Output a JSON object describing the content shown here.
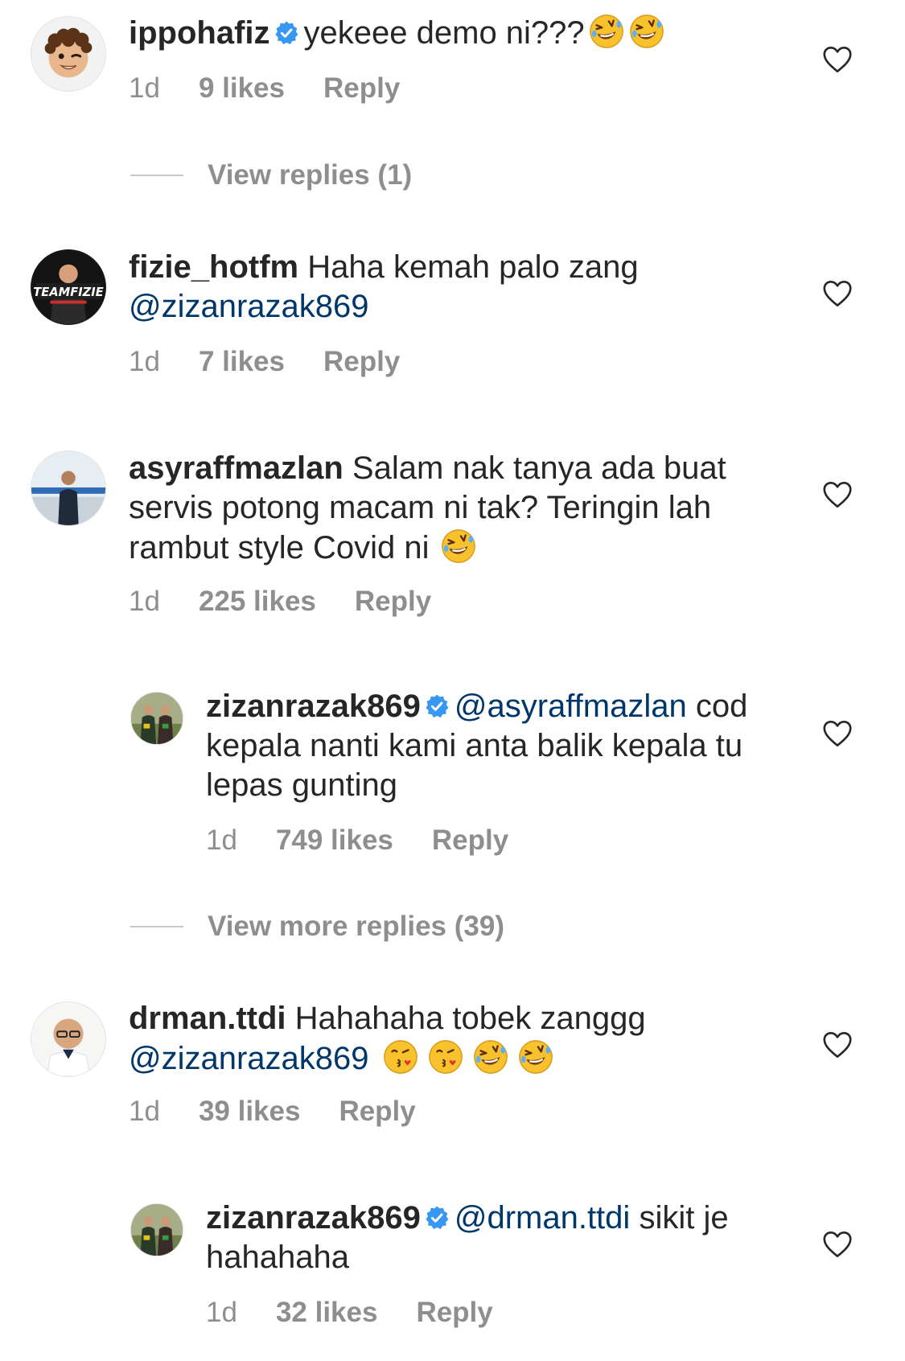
{
  "colors": {
    "text": "#262626",
    "secondary": "#8e8e8e",
    "mention": "#00376b",
    "verified": "#3897f0"
  },
  "comments": [
    {
      "username": "ippohafiz",
      "verified": true,
      "text": "yekeee demo ni???",
      "emojis": [
        "rofl-emoji",
        "rofl-emoji"
      ],
      "time": "1d",
      "likes": "9 likes",
      "reply": "Reply"
    },
    {
      "username": "fizie_hotfm",
      "verified": false,
      "text": "Haha kemah palo zang",
      "mention": "@zizanrazak869",
      "avatar_text": "TEAMFIZIE",
      "time": "1d",
      "likes": "7 likes",
      "reply": "Reply"
    },
    {
      "username": "asyraffmazlan",
      "verified": false,
      "text": "Salam nak tanya ada buat servis potong macam ni tak? Teringin lah rambut style Covid ni",
      "emojis": [
        "rofl-emoji"
      ],
      "time": "1d",
      "likes": "225 likes",
      "reply": "Reply"
    },
    {
      "username": "zizanrazak869",
      "verified": true,
      "mention": "@asyraffmazlan",
      "text": "cod kepala nanti kami anta balik kepala tu lepas gunting",
      "time": "1d",
      "likes": "749 likes",
      "reply": "Reply"
    },
    {
      "username": "drman.ttdi",
      "verified": false,
      "text": "Hahahaha tobek zanggg",
      "mention": "@zizanrazak869",
      "emojis": [
        "kiss-emoji",
        "kiss-emoji",
        "rofl-emoji",
        "rofl-emoji"
      ],
      "time": "1d",
      "likes": "39 likes",
      "reply": "Reply"
    },
    {
      "username": "zizanrazak869",
      "verified": true,
      "mention": "@drman.ttdi",
      "text": "sikit je hahahaha",
      "time": "1d",
      "likes": "32 likes",
      "reply": "Reply"
    }
  ],
  "view_replies": [
    {
      "label": "View replies (1)"
    },
    {
      "label": "View more replies (39)"
    }
  ]
}
